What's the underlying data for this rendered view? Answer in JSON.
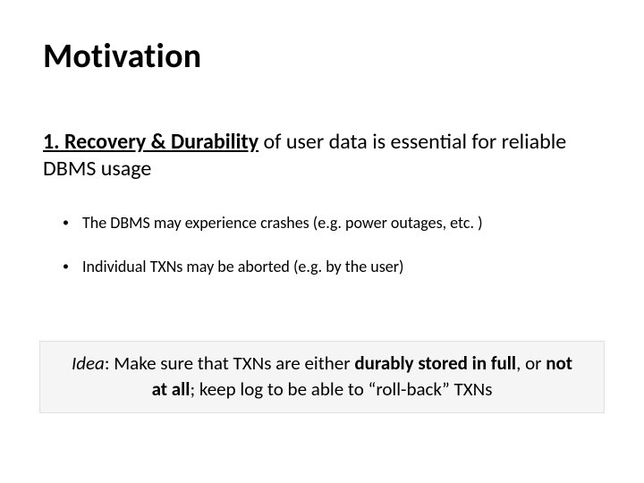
{
  "title": "Motivation",
  "point1": {
    "lead": "1. Recovery & Durability",
    "rest": " of user data is essential for reliable DBMS usage"
  },
  "bullets": [
    "The DBMS may experience crashes (e.g. power outages, etc. )",
    "Individual TXNs may be aborted (e.g. by the user)"
  ],
  "idea": {
    "label": "Idea",
    "sep": ": Make sure that TXNs are either ",
    "bold1": "durably stored in full",
    "mid": ", or ",
    "bold2": "not at all",
    "rest": "; keep log to be able to “roll-back” TXNs"
  }
}
